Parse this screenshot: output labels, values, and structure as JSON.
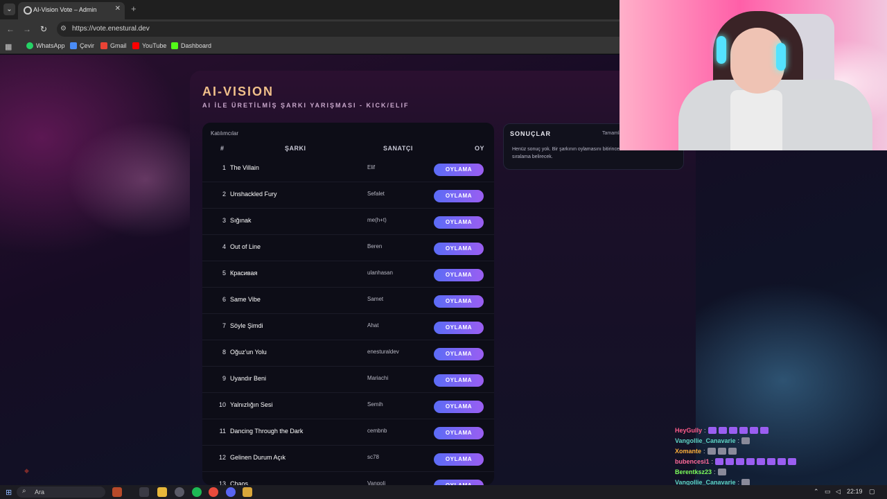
{
  "browser": {
    "tab_title": "AI-Vision Vote – Admin",
    "url": "https://vote.enestural.dev",
    "bookmarks": [
      {
        "label": "WhatsApp",
        "color": "#25d366"
      },
      {
        "label": "Çevir",
        "color": "#4a8cf7"
      },
      {
        "label": "Gmail",
        "color": "#ea4335"
      },
      {
        "label": "YouTube",
        "color": "#ff0000"
      },
      {
        "label": "Dashboard",
        "color": "#53fc18"
      }
    ]
  },
  "app": {
    "title": "AI-VISION",
    "subtitle": "AI İLE ÜRETİLMİŞ ŞARKI YARIŞMASI - KICK/ELIF"
  },
  "participants": {
    "label": "Katılımcılar",
    "columns": {
      "num": "#",
      "song": "ŞARKI",
      "artist": "SANATÇI",
      "vote": "OY"
    },
    "rows": [
      {
        "num": "1",
        "song": "The Villain",
        "artist": "Elif",
        "button": "OYLAMA"
      },
      {
        "num": "2",
        "song": "Unshackled Fury",
        "artist": "Sefalet",
        "button": "OYLAMA"
      },
      {
        "num": "3",
        "song": "Sığınak",
        "artist": "me(h+t)",
        "button": "OYLAMA"
      },
      {
        "num": "4",
        "song": "Out of Line",
        "artist": "Beren",
        "button": "OYLAMA"
      },
      {
        "num": "5",
        "song": "Красивая",
        "artist": "ulanhasan",
        "button": "OYLAMA"
      },
      {
        "num": "6",
        "song": "Same Vibe",
        "artist": "Samet",
        "button": "OYLAMA"
      },
      {
        "num": "7",
        "song": "Söyle Şimdi",
        "artist": "Ahat",
        "button": "OYLAMA"
      },
      {
        "num": "8",
        "song": "Oğuz'un Yolu",
        "artist": "enesturaldev",
        "button": "OYLAMA"
      },
      {
        "num": "9",
        "song": "Uyandır Beni",
        "artist": "Mariachi",
        "button": "OYLAMA"
      },
      {
        "num": "10",
        "song": "Yalnızlığın Sesi",
        "artist": "Semih",
        "button": "OYLAMA"
      },
      {
        "num": "11",
        "song": "Dancing Through the Dark",
        "artist": "cembnb",
        "button": "OYLAMA"
      },
      {
        "num": "12",
        "song": "Gelinen Durum Açık",
        "artist": "sc78",
        "button": "OYLAMA"
      },
      {
        "num": "13",
        "song": "Chaos",
        "artist": "Vangoli",
        "button": "OYLAMA"
      }
    ]
  },
  "results": {
    "title": "SONUÇLAR",
    "tag": "Tamamlanan",
    "empty_text": "Henüz sonuç yok. Bir şarkının oylamasını bitirince sıralama belirecek."
  },
  "chat": [
    {
      "user": "HeyGully",
      "color": "#ff5c8a",
      "message": ":",
      "emotes": 6
    },
    {
      "user": "Vangollie_Canavarie",
      "color": "#5fd6c6",
      "message": ":",
      "emotes": 1
    },
    {
      "user": "Xomante",
      "color": "#ffb13b",
      "message": ":",
      "emotes": 3
    },
    {
      "user": "bubencesi1",
      "color": "#ff6b9a",
      "message": ":",
      "emotes": 8
    },
    {
      "user": "Berentksz23",
      "color": "#7dff5c",
      "message": ":",
      "emotes": 1
    },
    {
      "user": "Vangollie_Canavarie",
      "color": "#5fd6c6",
      "message": ":",
      "emotes": 1
    }
  ],
  "taskbar": {
    "search_placeholder": "Ara",
    "clock": "22:19"
  }
}
